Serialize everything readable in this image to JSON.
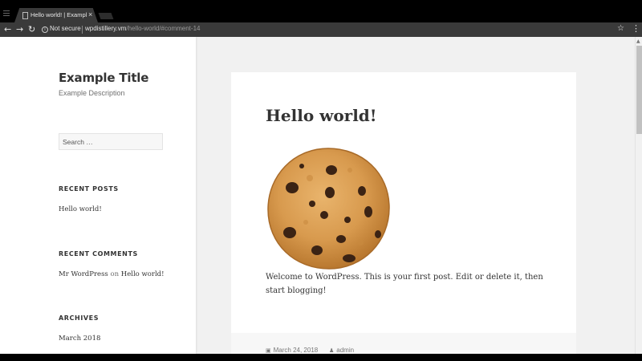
{
  "browser": {
    "tab_title": "Hello world! | Example Ti",
    "tab_close": "×",
    "back": "←",
    "forward": "→",
    "reload": "↻",
    "security_label": "Not secure",
    "url_host": "wpdistillery.vm",
    "url_path": "/hello-world/#comment-14",
    "bookmark_star": "☆",
    "menu_kebab": "⋮"
  },
  "sidebar": {
    "site_title": "Example Title",
    "site_description": "Example Description",
    "search_placeholder": "Search …",
    "recent_posts": {
      "title": "RECENT POSTS",
      "items": [
        "Hello world!"
      ]
    },
    "recent_comments": {
      "title": "RECENT COMMENTS",
      "author": "Mr WordPress",
      "connector": "on",
      "post": "Hello world!"
    },
    "archives": {
      "title": "ARCHIVES",
      "items": [
        "March 2018"
      ]
    }
  },
  "post": {
    "title": "Hello world!",
    "image_icon": "cookie",
    "body": "Welcome to WordPress. This is your first post. Edit or delete it, then start blogging!",
    "meta_date": "March 24, 2018",
    "meta_author": "admin"
  },
  "colors": {
    "page_bg": "#f1f1f1",
    "text": "#333333",
    "muted": "#707070",
    "chrome_dark": "#000000",
    "chrome_toolbar": "#3a3a3a"
  }
}
